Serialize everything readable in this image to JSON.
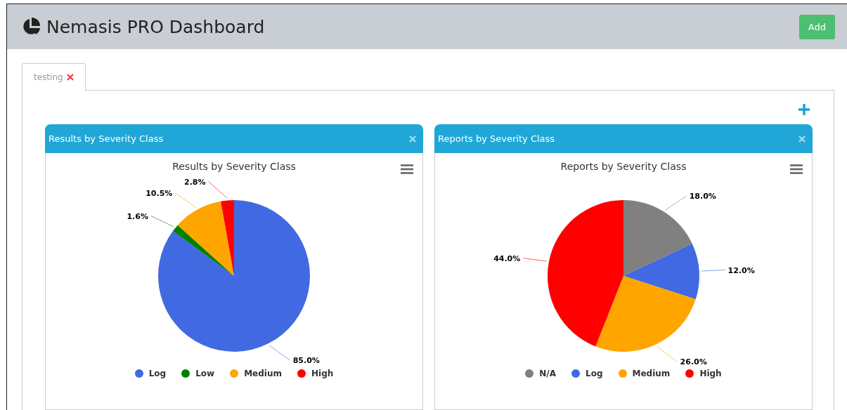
{
  "header": {
    "title": "Nemasis PRO Dashboard",
    "add_button": "Add"
  },
  "tabs": [
    {
      "label": "testing",
      "selected": true
    }
  ],
  "widgets": [
    {
      "header_title": "Results by Severity Class",
      "chart_data": {
        "type": "pie",
        "title": "Results by Severity Class",
        "categories": [
          "Log",
          "Low",
          "Medium",
          "High"
        ],
        "values": [
          85.0,
          1.6,
          10.5,
          2.8
        ],
        "colors": [
          "#4169e1",
          "#008000",
          "#ffa500",
          "#ff0000"
        ],
        "value_labels": [
          "85.0%",
          "1.6%",
          "10.5%",
          "2.8%"
        ],
        "legend": "bottom"
      }
    },
    {
      "header_title": "Reports by Severity Class",
      "chart_data": {
        "type": "pie",
        "title": "Reports by Severity Class",
        "categories": [
          "N/A",
          "Log",
          "Medium",
          "High"
        ],
        "values": [
          18.0,
          12.0,
          26.0,
          44.0
        ],
        "colors": [
          "#808080",
          "#4169e1",
          "#ffa500",
          "#ff0000"
        ],
        "value_labels": [
          "18.0%",
          "12.0%",
          "26.0%",
          "44.0%"
        ],
        "legend": "bottom"
      }
    }
  ]
}
